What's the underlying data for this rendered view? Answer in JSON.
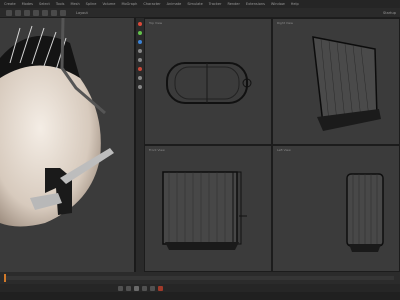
{
  "menubar": {
    "items": [
      "Create",
      "Modes",
      "Select",
      "Tools",
      "Mesh",
      "Spline",
      "Volume",
      "MoGraph",
      "Character",
      "Animate",
      "Simulate",
      "Tracker",
      "Render",
      "Extensions",
      "Window",
      "Help"
    ]
  },
  "toolbar": {
    "title": "Layout",
    "right_label": "Startup"
  },
  "viewports": {
    "top": {
      "label": "Top View"
    },
    "right": {
      "label": "Right View"
    },
    "front": {
      "label": "Front View"
    },
    "left": {
      "label": "Left View"
    }
  },
  "timeline": {
    "frame": 0
  },
  "status": {
    "text": ""
  },
  "colors": {
    "accent": "#d27a2a",
    "x_axis": "#d94a3a",
    "y_axis": "#63c24b",
    "z_axis": "#3c83d6"
  },
  "icons": [
    "move-icon",
    "scale-icon",
    "rotate-icon",
    "play-icon"
  ]
}
